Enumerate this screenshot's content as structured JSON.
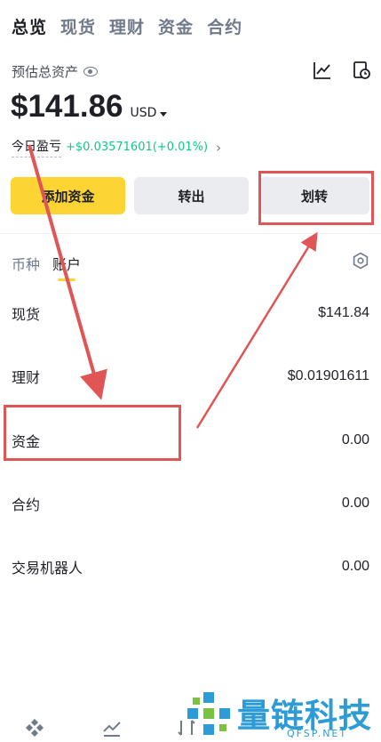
{
  "top_tabs": [
    "总览",
    "现货",
    "理财",
    "资金",
    "合约"
  ],
  "estimate": {
    "label": "预估总资产"
  },
  "balance": {
    "amount": "$141.86",
    "currency": "USD"
  },
  "pnl": {
    "label": "今日盈亏",
    "value": "+$0.03571601(+0.01%)"
  },
  "actions": {
    "add_funds": "添加资金",
    "withdraw": "转出",
    "transfer": "划转"
  },
  "sub_tabs": [
    "币种",
    "账户"
  ],
  "accounts": [
    {
      "name": "现货",
      "value": "$141.84"
    },
    {
      "name": "理财",
      "value": "$0.01901611"
    },
    {
      "name": "资金",
      "value": "0.00"
    },
    {
      "name": "合约",
      "value": "0.00"
    },
    {
      "name": "交易机器人",
      "value": "0.00"
    }
  ],
  "watermark": {
    "title": "量链科技",
    "site": "QFSP.NET"
  },
  "colors": {
    "accent": "#fcd535",
    "positive": "#0ecb81",
    "annotation": "#e05555",
    "watermark": "#2d9bd6"
  },
  "icons": [
    "eye-icon",
    "chart-icon",
    "history-icon",
    "settings-icon",
    "home-icon",
    "markets-icon",
    "trade-icon"
  ]
}
